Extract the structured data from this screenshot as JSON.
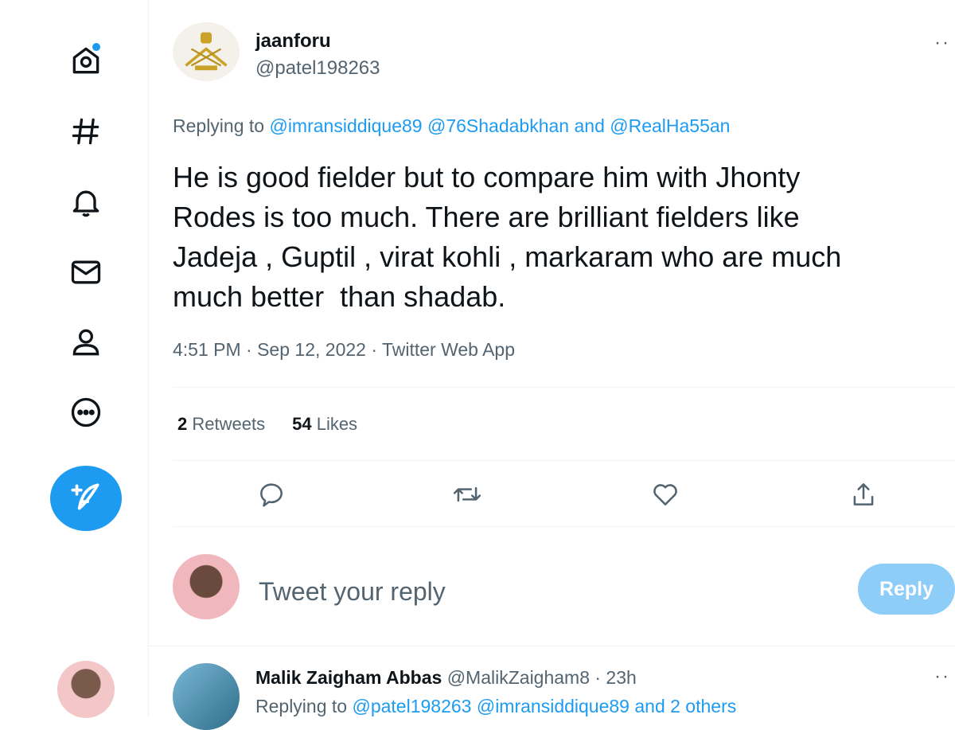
{
  "sidebar": {
    "items": [
      {
        "icon": "home-icon"
      },
      {
        "icon": "explore-hashtag-icon"
      },
      {
        "icon": "notifications-bell-icon"
      },
      {
        "icon": "messages-envelope-icon"
      },
      {
        "icon": "profile-person-icon"
      },
      {
        "icon": "more-circle-icon"
      }
    ],
    "compose_icon": "compose-tweet-icon"
  },
  "tweet": {
    "author_name": "jaanforu",
    "author_handle": "@patel198263",
    "replying_prefix": "Replying to",
    "replying_user1": "@imransiddique89",
    "replying_user2": "@76Shadabkhan",
    "replying_and": "and",
    "replying_user3": "@RealHa55an",
    "text": "He is good fielder but to compare him with Jhonty\nRodes is too much. There are brilliant fielders like\nJadeja , Guptil , virat kohli , markaram who are much\nmuch better  than shadab.",
    "meta": "4:51 PM · Sep 12, 2022 · Twitter Web App",
    "retweets_count": "2",
    "retweets_label": "Retweets",
    "likes_count": "54",
    "likes_label": "Likes"
  },
  "actions": [
    "reply-icon",
    "retweet-icon",
    "like-heart-icon",
    "share-icon"
  ],
  "composer": {
    "placeholder": "Tweet your reply",
    "button_label": "Reply"
  },
  "reply": {
    "author_name": "Malik Zaigham Abbas",
    "author_handle_time": "@MalikZaigham8 · 23h",
    "replying_prefix": "Replying to",
    "replying_user1": "@patel198263",
    "replying_user2": "@imransiddique89",
    "replying_others": "and 2 others"
  },
  "colors": {
    "accent": "#1d9bf0",
    "secondary_text": "#536471",
    "reply_button_disabled": "#8ecdf8"
  }
}
